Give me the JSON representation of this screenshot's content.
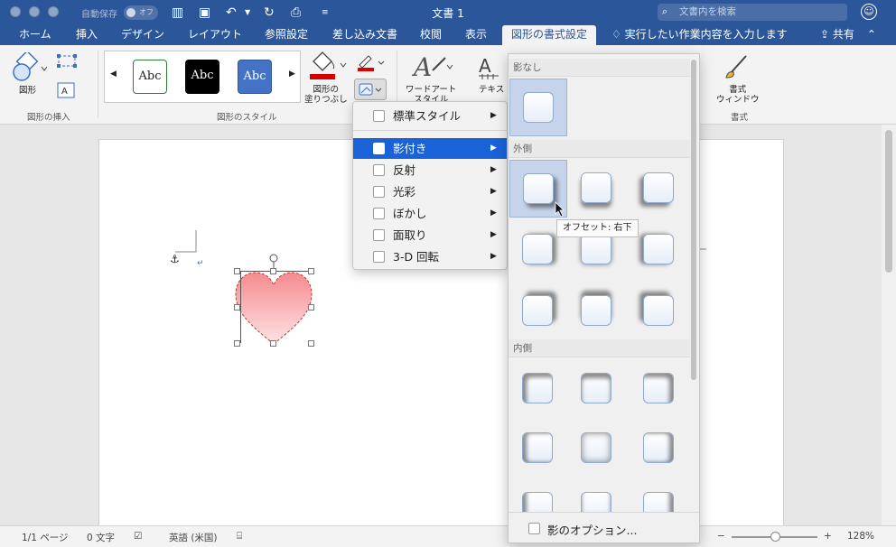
{
  "titlebar": {
    "autosave_label": "自動保存",
    "autosave_state": "オフ",
    "doc_title": "文書 1",
    "search_placeholder": "文書内を検索"
  },
  "tabs": [
    {
      "label": "ホーム"
    },
    {
      "label": "挿入"
    },
    {
      "label": "デザイン"
    },
    {
      "label": "レイアウト"
    },
    {
      "label": "参照設定"
    },
    {
      "label": "差し込み文書"
    },
    {
      "label": "校閲"
    },
    {
      "label": "表示"
    },
    {
      "label": "図形の書式設定"
    }
  ],
  "tell_me": "実行したい作業内容を入力します",
  "share_label": "共有",
  "ribbon": {
    "shapes_label": "図形",
    "insert_group": "図形の挿入",
    "style_group": "図形のスタイル",
    "style_samples": [
      "Abc",
      "Abc",
      "Abc"
    ],
    "fill_label_1": "図形の",
    "fill_label_2": "塗りつぶし",
    "wordart_label_1": "ワードアート",
    "wordart_label_2": "スタイル",
    "text_label": "テキス",
    "format_window_1": "書式",
    "format_window_2": "ウィンドウ",
    "format_group": "書式"
  },
  "effects_menu": {
    "items": [
      {
        "label": "標準スタイル"
      },
      {
        "label": "影付き"
      },
      {
        "label": "反射"
      },
      {
        "label": "光彩"
      },
      {
        "label": "ぼかし"
      },
      {
        "label": "面取り"
      },
      {
        "label": "3-D 回転"
      }
    ]
  },
  "shadow_gallery": {
    "sections": {
      "none": "影なし",
      "outer": "外側",
      "inner": "内側"
    },
    "tooltip": "オフセット: 右下",
    "options_label": "影のオプション..."
  },
  "status": {
    "page": "1/1 ページ",
    "words": "0 文字",
    "language": "英語 (米国)",
    "zoom": "128%"
  },
  "colors": {
    "accent": "#2b579a",
    "menu_highlight": "#1a62d8",
    "heart_fill_top": "#f58b8f",
    "heart_fill_bottom": "#fde3e5",
    "fill_color_bar": "#d80000"
  }
}
